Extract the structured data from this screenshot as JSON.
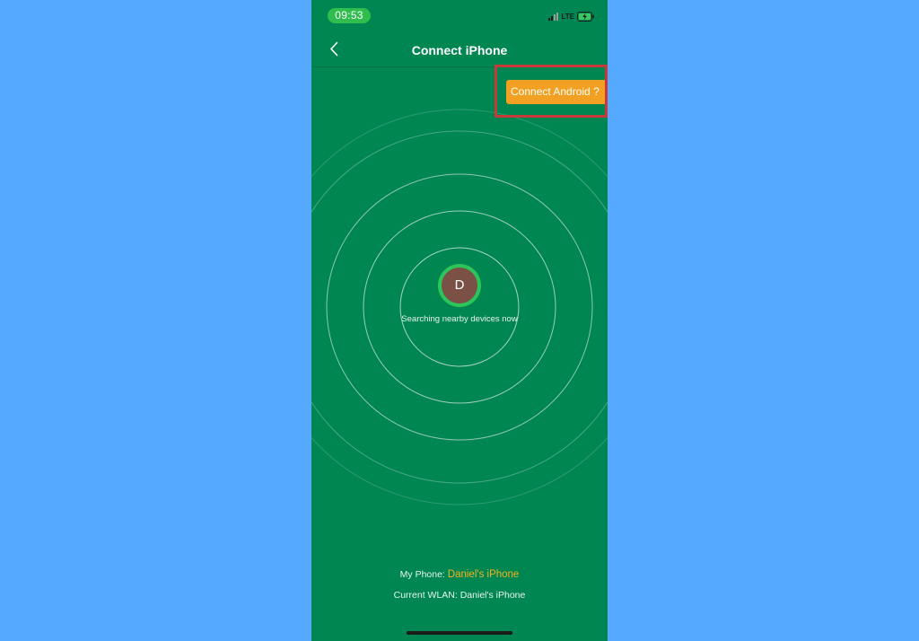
{
  "status_bar": {
    "time": "09:53",
    "network": "LTE"
  },
  "nav": {
    "title": "Connect iPhone",
    "back_icon": "chevron-left-icon"
  },
  "connect_android": {
    "label": "Connect Android ?"
  },
  "radar": {
    "avatar_letter": "D",
    "searching_text": "Searching nearby devices now"
  },
  "footer": {
    "my_phone_label": "My Phone: ",
    "my_phone_value": "Daniel's iPhone",
    "wlan_text": "Current WLAN: Daniel's iPhone"
  },
  "colors": {
    "background": "#55aaff",
    "screen": "#008651",
    "accent_orange": "#f1a022",
    "highlight_red": "#c83a3a",
    "avatar_ring": "#2cc55b",
    "avatar_fill": "#7a5144"
  }
}
